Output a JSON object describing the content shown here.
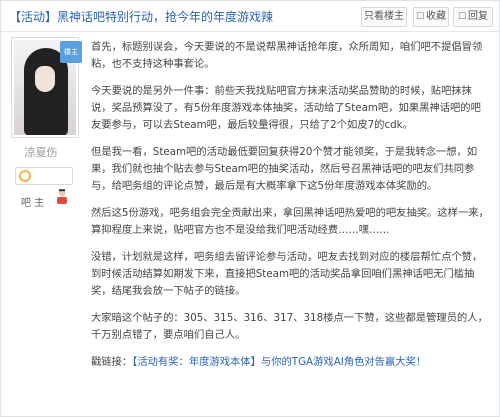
{
  "header": {
    "title": "【活动】黑神话吧特别行动，抢今年的年度游戏辣",
    "buttons": [
      {
        "label": "只看楼主",
        "icon": "none"
      },
      {
        "label": "收藏",
        "icon": "star-icon"
      },
      {
        "label": "回复",
        "icon": "reply-icon"
      }
    ]
  },
  "author": {
    "badge": "楼主",
    "name": "凉夏伤",
    "role_label": "吧 主"
  },
  "post": {
    "paragraphs": [
      "首先，标题别误会，今天要说的不是说帮黑神话抢年度，众所周知，咱们吧不提倡冒领粘，也不支持这种事套论。",
      "今天要说的是另外一件事：前些天我找贴吧官方抹来活动奖品赞助的时候，贴吧抹抹说，奖品预算没了，有5份年度游戏本体抽奖，活动给了Steam吧，如果黑神话吧的吧友要参与，可以去Steam吧，最后较量得很，只给了2个如皮7的cdk。",
      "但是我一看，Steam吧的活动最低要回复获得20个赞才能领奖，于是我转念一想，如果，我们就也抽个贴去参与Steam吧的抽奖活动，然后号召黑神话吧的吧友们共同参与，给吧务组的评论点赞，最后是有大概率拿下这5份年度游戏本体奖励的。",
      "然后这5份游戏，吧务组会完全贡献出来，拿回黑神话吧热爱吧的吧友抽奖。这样一来，算抑程度上来说，贴吧官方也不是没给我们吧活动经费……嘿……",
      "没错，计划就是这样，吧务组去留评论参与活动，吧友去找到对应的楼层帮忙点个赞，到时候活动结算如期发下来，直接把Steam吧的活动奖品拿回咱们黑神话吧无门槛抽奖，结尾我会放一下帖子的链接。",
      "大家暗这个帖子的：305、315、316、317、318楼点一下赞，这些都是管理员的人，千万别点错了，要点咱们自己人。"
    ],
    "link_prefix": "戳链接：",
    "link_text": "【活动有奖：年度游戏本体】与你的TGA游戏AI角色对告赢大奖！"
  }
}
